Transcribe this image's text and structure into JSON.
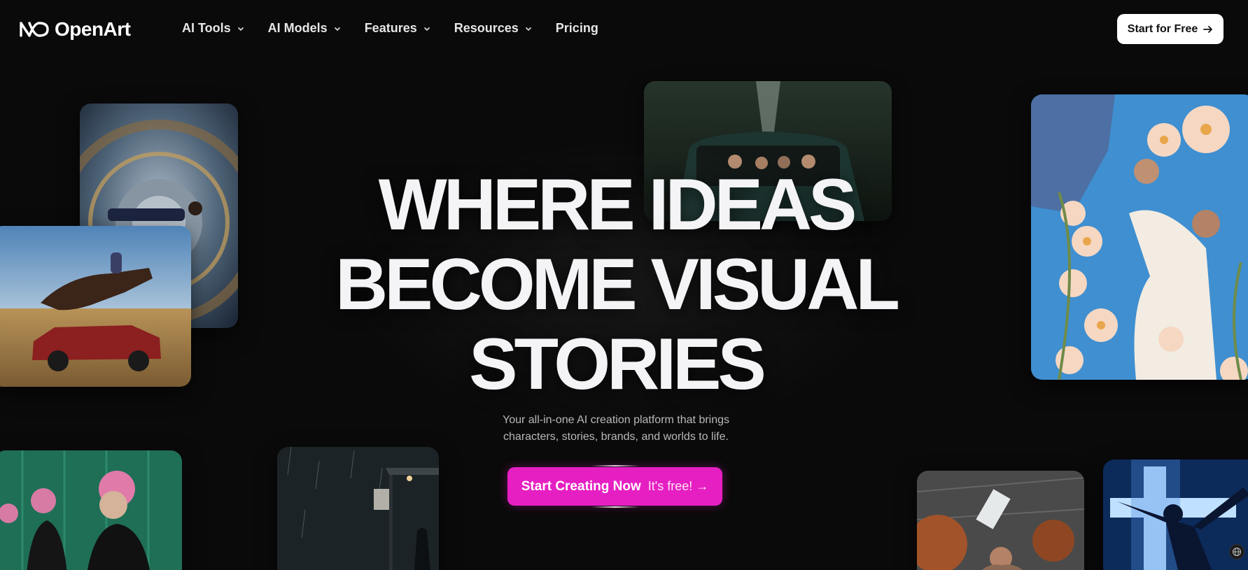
{
  "brand": {
    "name": "OpenArt"
  },
  "nav": {
    "items": [
      {
        "label": "AI Tools",
        "has_dropdown": true
      },
      {
        "label": "AI Models",
        "has_dropdown": true
      },
      {
        "label": "Features",
        "has_dropdown": true
      },
      {
        "label": "Resources",
        "has_dropdown": true
      },
      {
        "label": "Pricing",
        "has_dropdown": false
      }
    ],
    "cta_label": "Start for Free",
    "cta_icon": "arrow-right-icon"
  },
  "hero": {
    "headline_lines": [
      "WHERE IDEAS",
      "BECOME VISUAL",
      "STORIES"
    ],
    "subtitle_lines": [
      "Your all-in-one AI creation platform that brings",
      "characters, stories, brands, and worlds to life."
    ],
    "cta_primary": "Start Creating Now",
    "cta_secondary": "It's free! →"
  },
  "colors": {
    "background": "#0a0a0a",
    "accent": "#e61fc3",
    "nav_cta_bg": "#ffffff"
  },
  "icons": {
    "logo": "infinity-logo-icon",
    "dropdown": "chevron-down-icon",
    "language": "globe-icon"
  }
}
